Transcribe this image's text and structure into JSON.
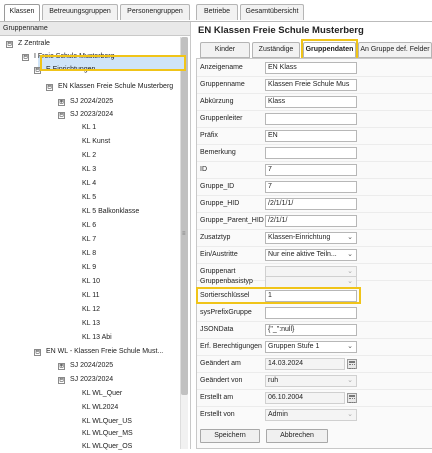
{
  "top_tabs": [
    {
      "label": "Klassen",
      "active": true
    },
    {
      "label": "Betreuungsgruppen",
      "active": false
    },
    {
      "label": "Personengruppen",
      "active": false
    },
    {
      "label": "Betriebe",
      "active": false
    },
    {
      "label": "Gesamtübersicht",
      "active": false
    }
  ],
  "tree": {
    "header": "Gruppenname",
    "rows": [
      {
        "label": "Z Zentrale",
        "toggle": "⊟"
      },
      {
        "label": "I Freie Schule Musterberg",
        "toggle": "⊟"
      },
      {
        "label": "E Einrichtungen",
        "toggle": "⊟"
      },
      {
        "label": "EN Klassen Freie Schule Musterberg",
        "toggle": "⊟",
        "selected": true
      },
      {
        "label": "SJ 2024/2025",
        "toggle": "⊞"
      },
      {
        "label": "SJ 2023/2024",
        "toggle": "⊟"
      },
      {
        "label": "KL 1"
      },
      {
        "label": "KL Kunst"
      },
      {
        "label": "KL 2"
      },
      {
        "label": "KL 3"
      },
      {
        "label": "KL 4"
      },
      {
        "label": "KL 5"
      },
      {
        "label": "KL 5 Balkonklasse"
      },
      {
        "label": "KL 6"
      },
      {
        "label": "KL 7"
      },
      {
        "label": "KL 8"
      },
      {
        "label": "KL 9"
      },
      {
        "label": "KL 10"
      },
      {
        "label": "KL 11"
      },
      {
        "label": "KL 12"
      },
      {
        "label": "KL 13"
      },
      {
        "label": "KL 13 Abi"
      },
      {
        "label": "EN WL - Klassen Freie Schule Must...",
        "toggle": "⊟"
      },
      {
        "label": "SJ 2024/2025",
        "toggle": "⊞"
      },
      {
        "label": "SJ 2023/2024",
        "toggle": "⊟"
      },
      {
        "label": "KL WL_Quer"
      },
      {
        "label": "KL WL2024"
      },
      {
        "label": "KL WLQuer_US"
      },
      {
        "label": "KL WLQuer_MS"
      },
      {
        "label": "KL WLQuer_OS"
      }
    ],
    "grip": "≡"
  },
  "detail": {
    "title": "EN Klassen Freie Schule Musterberg",
    "tabs": [
      {
        "label": "Kinder",
        "active": false
      },
      {
        "label": "Zuständige",
        "active": false
      },
      {
        "label": "Gruppendaten",
        "active": true
      },
      {
        "label": "An Gruppe def. Felder",
        "active": false
      }
    ],
    "fields": [
      {
        "label": "Anzeigename",
        "value": "EN Klass",
        "kind": "input"
      },
      {
        "label": "Gruppenname",
        "value": "Klassen Freie Schule Mus",
        "kind": "input"
      },
      {
        "label": "Abkürzung",
        "value": "Klass",
        "kind": "input"
      },
      {
        "label": "Gruppenleiter",
        "value": "",
        "kind": "input"
      },
      {
        "label": "Präfix",
        "value": "EN",
        "kind": "input"
      },
      {
        "label": "Bemerkung",
        "value": "",
        "kind": "input"
      },
      {
        "label": "ID",
        "value": "7",
        "kind": "input"
      },
      {
        "label": "Gruppe_ID",
        "value": "7",
        "kind": "input"
      },
      {
        "label": "Gruppe_HID",
        "value": "/2/1/1/1/",
        "kind": "input"
      },
      {
        "label": "Gruppe_Parent_HID",
        "value": "/2/1/1/",
        "kind": "input"
      },
      {
        "label": "Zusatztyp",
        "value": "Klassen-Einrichtung",
        "kind": "select"
      },
      {
        "label": "Ein/Austritte",
        "value": "Nur eine aktive Teiln...",
        "kind": "select"
      },
      {
        "label": "Gruppenart",
        "value": "",
        "kind": "select-dis"
      },
      {
        "label": "Gruppenbasistyp",
        "value": "",
        "kind": "select-dis"
      },
      {
        "label": "Sortierschlüssel",
        "value": "1",
        "kind": "input"
      },
      {
        "label": "sysPrefixGruppe",
        "value": "",
        "kind": "input"
      },
      {
        "label": "JSONData",
        "value": "{\"_\":null}",
        "kind": "input"
      },
      {
        "label": "Erf. Berechtigungen",
        "value": "Gruppen Stufe 1",
        "kind": "select"
      },
      {
        "label": "Geändert am",
        "value": "14.03.2024",
        "kind": "date-dis"
      },
      {
        "label": "Geändert von",
        "value": "ruh",
        "kind": "select-dis"
      },
      {
        "label": "Erstellt am",
        "value": "06.10.2004",
        "kind": "date-dis"
      },
      {
        "label": "Erstellt von",
        "value": "Admin",
        "kind": "select-dis"
      }
    ],
    "save_label": "Speichern",
    "cancel_label": "Abbrechen"
  },
  "icons": {
    "chevron": "chevron-down-icon",
    "calendar": "calendar-icon",
    "expand": "plus-box-icon",
    "collapse": "minus-box-icon"
  },
  "colors": {
    "highlight": "#f0c419",
    "selection": "#cfe4f8"
  }
}
